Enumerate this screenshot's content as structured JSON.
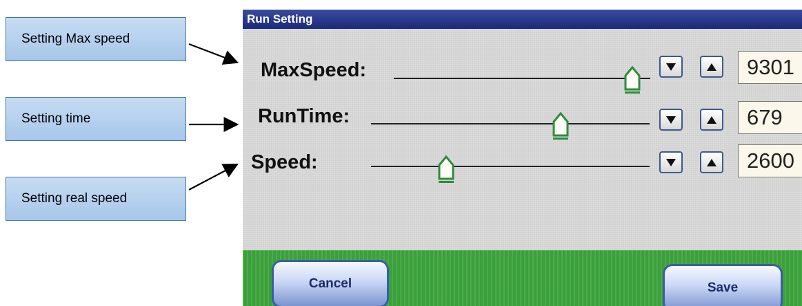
{
  "callouts": {
    "max_speed": "Setting Max speed",
    "time": "Setting time",
    "real_speed": "Setting real speed"
  },
  "window": {
    "title": "Run Setting"
  },
  "rows": [
    {
      "label": "MaxSpeed:",
      "value": "9301",
      "slider_fraction": 0.93
    },
    {
      "label": "RunTime:",
      "value": "679",
      "slider_fraction": 0.68
    },
    {
      "label": "Speed:",
      "value": "2600",
      "slider_fraction": 0.27
    }
  ],
  "buttons": {
    "cancel": "Cancel",
    "save": "Save"
  },
  "icons": {
    "down": "down-triangle-icon",
    "up": "up-triangle-icon",
    "thumb": "slider-thumb-icon"
  },
  "colors": {
    "title_bar": "#1b2a79",
    "bottom_bar": "#3aa13a",
    "thumb_accent": "#2e8b3a"
  }
}
